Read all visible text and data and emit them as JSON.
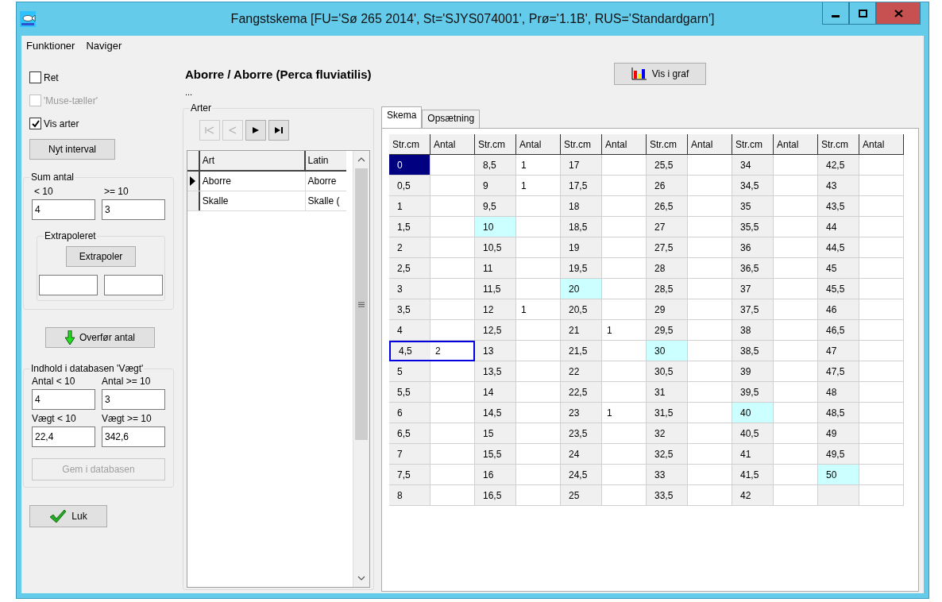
{
  "window": {
    "title": "Fangstskema  [FU='Sø 265 2014', St='SJYS074001', Prø='1.1B', RUS='Standardgarn']"
  },
  "menu": [
    "Funktioner",
    "Naviger"
  ],
  "options": [
    {
      "label": "Ret",
      "checked": false,
      "disabled": false
    },
    {
      "label": "'Muse-tæller'",
      "checked": false,
      "disabled": true
    },
    {
      "label": "Vis arter",
      "checked": true,
      "disabled": false
    }
  ],
  "new_interval_button": "Nyt interval",
  "sum_antal": {
    "title": "Sum antal",
    "fields": [
      {
        "label": "< 10",
        "value": "4"
      },
      {
        "label": ">= 10",
        "value": "3"
      }
    ],
    "extrapolated": {
      "title": "Extrapoleret",
      "button": "Extrapoler"
    }
  },
  "transfer_button": "Overfør antal",
  "database": {
    "title": "Indhold i databasen 'Vægt'",
    "fields": [
      {
        "label": "Antal < 10",
        "value": "4"
      },
      {
        "label": "Antal >= 10",
        "value": "3"
      },
      {
        "label": "Vægt < 10",
        "value": "22,4"
      },
      {
        "label": "Vægt >= 10",
        "value": "342,6"
      }
    ],
    "save_button": {
      "label": "Gem i databasen",
      "disabled": true
    }
  },
  "close_button": "Luk",
  "species_title": "Aborre / Aborre (Perca fluviatilis)",
  "species_subtitle": "...",
  "species": {
    "title": "Arter",
    "nav": [
      {
        "kind": "first",
        "disabled": true
      },
      {
        "kind": "prev",
        "disabled": true
      },
      {
        "kind": "next",
        "disabled": false
      },
      {
        "kind": "last",
        "disabled": false
      }
    ],
    "columns": [
      "Art",
      "Latin"
    ],
    "rows": [
      {
        "art": "Aborre",
        "latin": "Aborre",
        "current": true
      },
      {
        "art": "Skalle",
        "latin": "Skalle (",
        "current": false
      }
    ]
  },
  "graph_button": "Vis i graf",
  "tabs": [
    {
      "label": "Skema",
      "selected": true
    },
    {
      "label": "Opsætning",
      "selected": false
    }
  ],
  "grid": {
    "headers": [
      "Str.cm",
      "Antal",
      "Str.cm",
      "Antal",
      "Str.cm",
      "Antal",
      "Str.cm",
      "Antal",
      "Str.cm",
      "Antal",
      "Str.cm",
      "Antal"
    ],
    "rows": [
      [
        {
          "size": "0",
          "selected": true,
          "focused": false,
          "marked": false
        },
        {
          "size": "8,5",
          "antal": "1",
          "selected": false,
          "focused": false,
          "marked": false
        },
        {
          "size": "17",
          "selected": false,
          "focused": false,
          "marked": false
        },
        {
          "size": "25,5",
          "selected": false,
          "focused": false,
          "marked": false
        },
        {
          "size": "34",
          "selected": false,
          "focused": false,
          "marked": false
        },
        {
          "size": "42,5",
          "selected": false,
          "focused": false,
          "marked": false
        }
      ],
      [
        {
          "size": "0,5",
          "selected": false,
          "focused": false,
          "marked": false
        },
        {
          "size": "9",
          "antal": "1",
          "selected": false,
          "focused": false,
          "marked": false
        },
        {
          "size": "17,5",
          "selected": false,
          "focused": false,
          "marked": false
        },
        {
          "size": "26",
          "selected": false,
          "focused": false,
          "marked": false
        },
        {
          "size": "34,5",
          "selected": false,
          "focused": false,
          "marked": false
        },
        {
          "size": "43",
          "selected": false,
          "focused": false,
          "marked": false
        }
      ],
      [
        {
          "size": "1",
          "selected": false,
          "focused": false,
          "marked": false
        },
        {
          "size": "9,5",
          "selected": false,
          "focused": false,
          "marked": false
        },
        {
          "size": "18",
          "selected": false,
          "focused": false,
          "marked": false
        },
        {
          "size": "26,5",
          "selected": false,
          "focused": false,
          "marked": false
        },
        {
          "size": "35",
          "selected": false,
          "focused": false,
          "marked": false
        },
        {
          "size": "43,5",
          "selected": false,
          "focused": false,
          "marked": false
        }
      ],
      [
        {
          "size": "1,5",
          "selected": false,
          "focused": false,
          "marked": false
        },
        {
          "size": "10",
          "selected": false,
          "focused": false,
          "marked": true
        },
        {
          "size": "18,5",
          "selected": false,
          "focused": false,
          "marked": false
        },
        {
          "size": "27",
          "selected": false,
          "focused": false,
          "marked": false
        },
        {
          "size": "35,5",
          "selected": false,
          "focused": false,
          "marked": false
        },
        {
          "size": "44",
          "selected": false,
          "focused": false,
          "marked": false
        }
      ],
      [
        {
          "size": "2",
          "selected": false,
          "focused": false,
          "marked": false
        },
        {
          "size": "10,5",
          "selected": false,
          "focused": false,
          "marked": false
        },
        {
          "size": "19",
          "selected": false,
          "focused": false,
          "marked": false
        },
        {
          "size": "27,5",
          "selected": false,
          "focused": false,
          "marked": false
        },
        {
          "size": "36",
          "selected": false,
          "focused": false,
          "marked": false
        },
        {
          "size": "44,5",
          "selected": false,
          "focused": false,
          "marked": false
        }
      ],
      [
        {
          "size": "2,5",
          "selected": false,
          "focused": false,
          "marked": false
        },
        {
          "size": "11",
          "selected": false,
          "focused": false,
          "marked": false
        },
        {
          "size": "19,5",
          "selected": false,
          "focused": false,
          "marked": false
        },
        {
          "size": "28",
          "selected": false,
          "focused": false,
          "marked": false
        },
        {
          "size": "36,5",
          "selected": false,
          "focused": false,
          "marked": false
        },
        {
          "size": "45",
          "selected": false,
          "focused": false,
          "marked": false
        }
      ],
      [
        {
          "size": "3",
          "selected": false,
          "focused": false,
          "marked": false
        },
        {
          "size": "11,5",
          "selected": false,
          "focused": false,
          "marked": false
        },
        {
          "size": "20",
          "selected": false,
          "focused": false,
          "marked": true
        },
        {
          "size": "28,5",
          "selected": false,
          "focused": false,
          "marked": false
        },
        {
          "size": "37",
          "selected": false,
          "focused": false,
          "marked": false
        },
        {
          "size": "45,5",
          "selected": false,
          "focused": false,
          "marked": false
        }
      ],
      [
        {
          "size": "3,5",
          "selected": false,
          "focused": false,
          "marked": false
        },
        {
          "size": "12",
          "antal": "1",
          "selected": false,
          "focused": false,
          "marked": false
        },
        {
          "size": "20,5",
          "selected": false,
          "focused": false,
          "marked": false
        },
        {
          "size": "29",
          "selected": false,
          "focused": false,
          "marked": false
        },
        {
          "size": "37,5",
          "selected": false,
          "focused": false,
          "marked": false
        },
        {
          "size": "46",
          "selected": false,
          "focused": false,
          "marked": false
        }
      ],
      [
        {
          "size": "4",
          "selected": false,
          "focused": false,
          "marked": false
        },
        {
          "size": "12,5",
          "selected": false,
          "focused": false,
          "marked": false
        },
        {
          "size": "21",
          "antal": "1",
          "selected": false,
          "focused": false,
          "marked": false
        },
        {
          "size": "29,5",
          "selected": false,
          "focused": false,
          "marked": false
        },
        {
          "size": "38",
          "selected": false,
          "focused": false,
          "marked": false
        },
        {
          "size": "46,5",
          "selected": false,
          "focused": false,
          "marked": false
        }
      ],
      [
        {
          "size": "4,5",
          "antal": "2",
          "selected": false,
          "focused": true,
          "marked": false
        },
        {
          "size": "13",
          "selected": false,
          "focused": false,
          "marked": false
        },
        {
          "size": "21,5",
          "selected": false,
          "focused": false,
          "marked": false
        },
        {
          "size": "30",
          "selected": false,
          "focused": false,
          "marked": true
        },
        {
          "size": "38,5",
          "selected": false,
          "focused": false,
          "marked": false
        },
        {
          "size": "47",
          "selected": false,
          "focused": false,
          "marked": false
        }
      ],
      [
        {
          "size": "5",
          "selected": false,
          "focused": false,
          "marked": false
        },
        {
          "size": "13,5",
          "selected": false,
          "focused": false,
          "marked": false
        },
        {
          "size": "22",
          "selected": false,
          "focused": false,
          "marked": false
        },
        {
          "size": "30,5",
          "selected": false,
          "focused": false,
          "marked": false
        },
        {
          "size": "39",
          "selected": false,
          "focused": false,
          "marked": false
        },
        {
          "size": "47,5",
          "selected": false,
          "focused": false,
          "marked": false
        }
      ],
      [
        {
          "size": "5,5",
          "selected": false,
          "focused": false,
          "marked": false
        },
        {
          "size": "14",
          "selected": false,
          "focused": false,
          "marked": false
        },
        {
          "size": "22,5",
          "selected": false,
          "focused": false,
          "marked": false
        },
        {
          "size": "31",
          "selected": false,
          "focused": false,
          "marked": false
        },
        {
          "size": "39,5",
          "selected": false,
          "focused": false,
          "marked": false
        },
        {
          "size": "48",
          "selected": false,
          "focused": false,
          "marked": false
        }
      ],
      [
        {
          "size": "6",
          "selected": false,
          "focused": false,
          "marked": false
        },
        {
          "size": "14,5",
          "selected": false,
          "focused": false,
          "marked": false
        },
        {
          "size": "23",
          "antal": "1",
          "selected": false,
          "focused": false,
          "marked": false
        },
        {
          "size": "31,5",
          "selected": false,
          "focused": false,
          "marked": false
        },
        {
          "size": "40",
          "selected": false,
          "focused": false,
          "marked": true
        },
        {
          "size": "48,5",
          "selected": false,
          "focused": false,
          "marked": false
        }
      ],
      [
        {
          "size": "6,5",
          "selected": false,
          "focused": false,
          "marked": false
        },
        {
          "size": "15",
          "selected": false,
          "focused": false,
          "marked": false
        },
        {
          "size": "23,5",
          "selected": false,
          "focused": false,
          "marked": false
        },
        {
          "size": "32",
          "selected": false,
          "focused": false,
          "marked": false
        },
        {
          "size": "40,5",
          "selected": false,
          "focused": false,
          "marked": false
        },
        {
          "size": "49",
          "selected": false,
          "focused": false,
          "marked": false
        }
      ],
      [
        {
          "size": "7",
          "selected": false,
          "focused": false,
          "marked": false
        },
        {
          "size": "15,5",
          "selected": false,
          "focused": false,
          "marked": false
        },
        {
          "size": "24",
          "selected": false,
          "focused": false,
          "marked": false
        },
        {
          "size": "32,5",
          "selected": false,
          "focused": false,
          "marked": false
        },
        {
          "size": "41",
          "selected": false,
          "focused": false,
          "marked": false
        },
        {
          "size": "49,5",
          "selected": false,
          "focused": false,
          "marked": false
        }
      ],
      [
        {
          "size": "7,5",
          "selected": false,
          "focused": false,
          "marked": false
        },
        {
          "size": "16",
          "selected": false,
          "focused": false,
          "marked": false
        },
        {
          "size": "24,5",
          "selected": false,
          "focused": false,
          "marked": false
        },
        {
          "size": "33",
          "selected": false,
          "focused": false,
          "marked": false
        },
        {
          "size": "41,5",
          "selected": false,
          "focused": false,
          "marked": false
        },
        {
          "size": "50",
          "selected": false,
          "focused": false,
          "marked": true
        }
      ],
      [
        {
          "size": "8",
          "selected": false,
          "focused": false,
          "marked": false
        },
        {
          "size": "16,5",
          "selected": false,
          "focused": false,
          "marked": false
        },
        {
          "size": "25",
          "selected": false,
          "focused": false,
          "marked": false
        },
        {
          "size": "33,5",
          "selected": false,
          "focused": false,
          "marked": false
        },
        {
          "size": "42",
          "selected": false,
          "focused": false,
          "marked": false
        },
        {
          "selected": false,
          "focused": false,
          "marked": false
        }
      ]
    ]
  }
}
